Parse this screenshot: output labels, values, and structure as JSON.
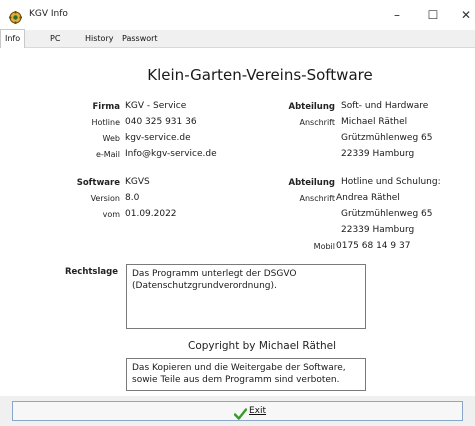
{
  "window": {
    "title": "KGV Info",
    "minimize_glyph": "–",
    "maximize_glyph": "☐",
    "close_glyph": "✕"
  },
  "tabs": [
    {
      "label": "Info",
      "active": true
    },
    {
      "label": "PC",
      "active": false
    },
    {
      "label": "History",
      "active": false
    },
    {
      "label": "Passwort",
      "active": false
    }
  ],
  "heading": "Klein-Garten-Vereins-Software",
  "left_block": {
    "firma_label": "Firma",
    "firma": "KGV - Service",
    "hotline_label": "Hotline",
    "hotline": "040 325 931 36",
    "web_label": "Web",
    "web": "kgv-service.de",
    "email_label": "e-Mail",
    "email": "Info@kgv-service.de",
    "software_label": "Software",
    "software": "KGVS",
    "version_label": "Version",
    "version": "8.0",
    "vom_label": "vom",
    "vom": "01.09.2022"
  },
  "right_block": {
    "abteilung1_label": "Abteilung",
    "abteilung1": "Soft- und Hardware",
    "anschrift1_label": "Anschrift",
    "anschrift1": [
      "Michael Räthel",
      "Grützmühlenweg 65",
      "22339 Hamburg"
    ],
    "abteilung2_label": "Abteilung",
    "abteilung2": "Hotline und Schulung:",
    "anschrift2_label": "Anschrift",
    "anschrift2": [
      "Andrea Räthel",
      "Grützmühlenweg 65",
      "22339 Hamburg"
    ],
    "mobil_label": "Mobil",
    "mobil": "0175 68 14 9 37"
  },
  "rechtslage": {
    "label": "Rechtslage",
    "text": "Das Programm unterlegt der DSGVO (Datenschutzgrundverordnung)."
  },
  "copyright": "Copyright by Michael Räthel",
  "notice": "Das Kopieren und die Weitergabe der Software, sowie Teile aus dem  Programm sind verboten.",
  "footer": {
    "exit_label": "Exit",
    "exit_icon": "checkmark-icon",
    "check_color": "#3a9a2a"
  },
  "colors": {
    "button_border": "#8aa6c8",
    "tab_bg": "#f0f0f0"
  }
}
